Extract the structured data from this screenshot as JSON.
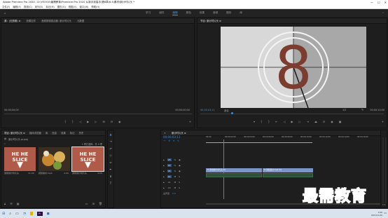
{
  "window": {
    "title": "Adobe Premiere Pro 2020 - D:\\YEOOO\\最需教育\\Premiere Pro 2020 从新手到高手\\第6章\\6.4\\素材\\倒计时片头 *",
    "controls": [
      "—",
      "☐",
      "✕"
    ]
  },
  "menu": [
    "文件(F)",
    "编辑(E)",
    "剪辑(C)",
    "序列(S)",
    "标记(M)",
    "图形(G)",
    "视图(V)",
    "窗口(W)",
    "帮助(H)"
  ],
  "workspaces": [
    "学习",
    "组件",
    "编辑",
    "颜色",
    "效果",
    "音频",
    "图形",
    "库"
  ],
  "workspace_active": "编辑",
  "source_panel": {
    "tabs": [
      "源：(无剪辑) ≡",
      "效果控件",
      "音频剪辑混合器: 倒计时片头",
      "元数据"
    ],
    "timecode_left": "00;00;00;00",
    "timecode_right": "00;00;00;00"
  },
  "program_panel": {
    "tab": "节目: 倒计时片头 ≡",
    "timecode": "00;00;03;11",
    "fit": "适合",
    "scale": "1/2",
    "duration": "00;00;10;00",
    "leader_number": "8"
  },
  "project_panel": {
    "tabs": [
      "项目: 倒计时片头 ≡",
      "媒体浏览器",
      "库",
      "信息",
      "效果",
      "标记",
      "历史"
    ],
    "file": "倒计时片头.prproj",
    "count": "1 项已选择，共 4 项",
    "items": [
      {
        "name": "通用倒计时片头",
        "duration": "11;29",
        "art": "HE HE SLICE",
        "color": "#b05a4a"
      },
      {
        "name": "视频素材.mp4",
        "duration": "4;09",
        "art": "food",
        "color": "#8a6a3a"
      },
      {
        "name": "通用倒计时片头",
        "duration": "4;29",
        "art": "HE HE SLICE",
        "color": "#b05a4a"
      }
    ]
  },
  "timeline": {
    "tab": "倒计时片头 ≡",
    "timecode": "00;00;03;11",
    "ruler": [
      "00;00",
      "00;00;02;00",
      "00;00;04;00",
      "00;00;06;00",
      "00;00;08;00",
      "00;00;10;00",
      "00;00;12;00",
      "00;00;14;00",
      "00;00;16;00"
    ],
    "tracks": [
      "V3",
      "V2",
      "V1",
      "A1",
      "A2",
      "A3"
    ],
    "master": "主声道",
    "master_value": "0.0",
    "clips": [
      {
        "label": "fx 通用倒计时片头 [V]",
        "track": "V1"
      },
      {
        "label": "fx 视频素材.mp4 [V]",
        "track": "V1"
      }
    ]
  },
  "watermark": "最需教育",
  "taskbar": {
    "time": "9:46",
    "date": "2021/11/26"
  }
}
